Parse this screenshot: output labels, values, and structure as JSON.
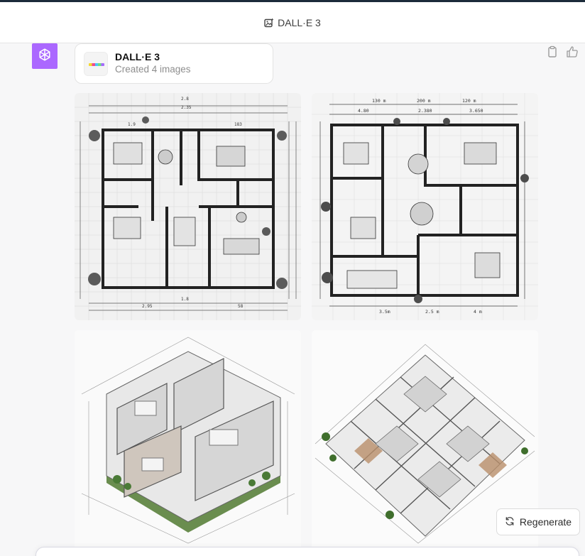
{
  "header": {
    "title": "DALL·E 3",
    "icon": "image-sparkle-icon"
  },
  "assistant": {
    "avatar_icon": "openai-logo-icon",
    "avatar_color": "#ab68ff"
  },
  "tool_card": {
    "name": "DALL·E 3",
    "status": "Created 4 images"
  },
  "message_actions": [
    "copy-icon",
    "thumbs-up-icon"
  ],
  "images": [
    {
      "kind": "2D floor plan blueprint",
      "labels": [
        "2.8",
        "2.35",
        "1.9",
        "38",
        "183",
        "1.8",
        "2.95",
        "58"
      ]
    },
    {
      "kind": "2D floor plan blueprint",
      "labels": [
        "130 m",
        "200 m",
        "120 m",
        "4.80",
        "2.380",
        "3.650",
        "2.5 m",
        "4 m",
        "3.5m"
      ]
    },
    {
      "kind": "3D isometric cutaway",
      "labels": []
    },
    {
      "kind": "3D isometric cutaway",
      "labels": []
    }
  ],
  "regenerate": {
    "label": "Regenerate",
    "icon": "refresh-icon"
  }
}
